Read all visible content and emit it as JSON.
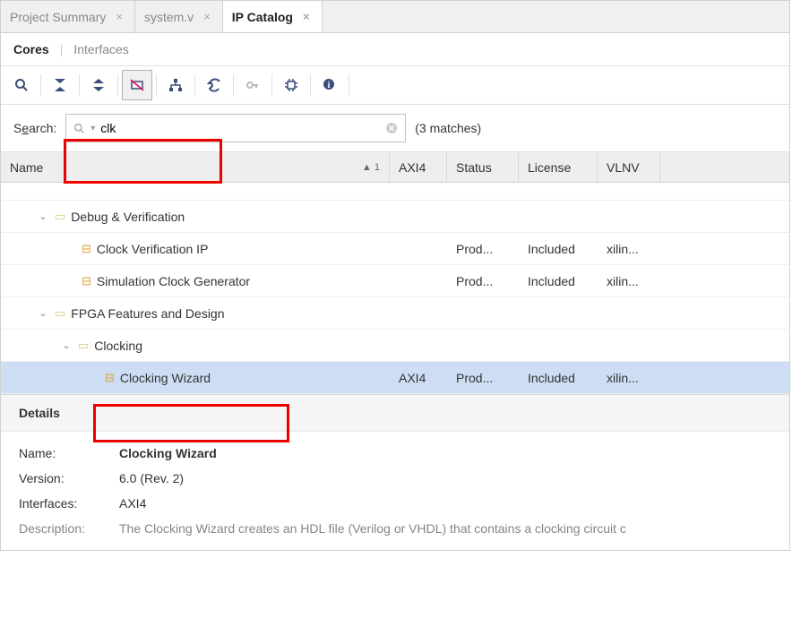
{
  "tabs": [
    {
      "label": "Project Summary",
      "active": false
    },
    {
      "label": "system.v",
      "active": false
    },
    {
      "label": "IP Catalog",
      "active": true
    }
  ],
  "subtabs": {
    "cores": "Cores",
    "interfaces": "Interfaces"
  },
  "search": {
    "label_pre": "S",
    "label_u": "e",
    "label_post": "arch:",
    "value": "clk",
    "matches": "(3 matches)"
  },
  "columns": {
    "name": "Name",
    "axi4": "AXI4",
    "status": "Status",
    "license": "License",
    "vlnv": "VLNV",
    "sort": "1"
  },
  "tree": {
    "g1": {
      "label": "Debug & Verification"
    },
    "r1": {
      "name": "Clock Verification IP",
      "axi4": "",
      "status": "Prod...",
      "license": "Included",
      "vlnv": "xilin..."
    },
    "r2": {
      "name": "Simulation Clock Generator",
      "axi4": "",
      "status": "Prod...",
      "license": "Included",
      "vlnv": "xilin..."
    },
    "g2": {
      "label": "FPGA Features and Design"
    },
    "g3": {
      "label": "Clocking"
    },
    "r3": {
      "name": "Clocking Wizard",
      "axi4": "AXI4",
      "status": "Prod...",
      "license": "Included",
      "vlnv": "xilin..."
    }
  },
  "details": {
    "title": "Details",
    "name_label": "Name:",
    "name_value": "Clocking Wizard",
    "version_label": "Version:",
    "version_value": "6.0 (Rev. 2)",
    "interfaces_label": "Interfaces:",
    "interfaces_value": "AXI4",
    "description_label": "Description:",
    "description_value": "The Clocking Wizard creates an HDL file (Verilog or VHDL) that contains a clocking circuit c"
  }
}
